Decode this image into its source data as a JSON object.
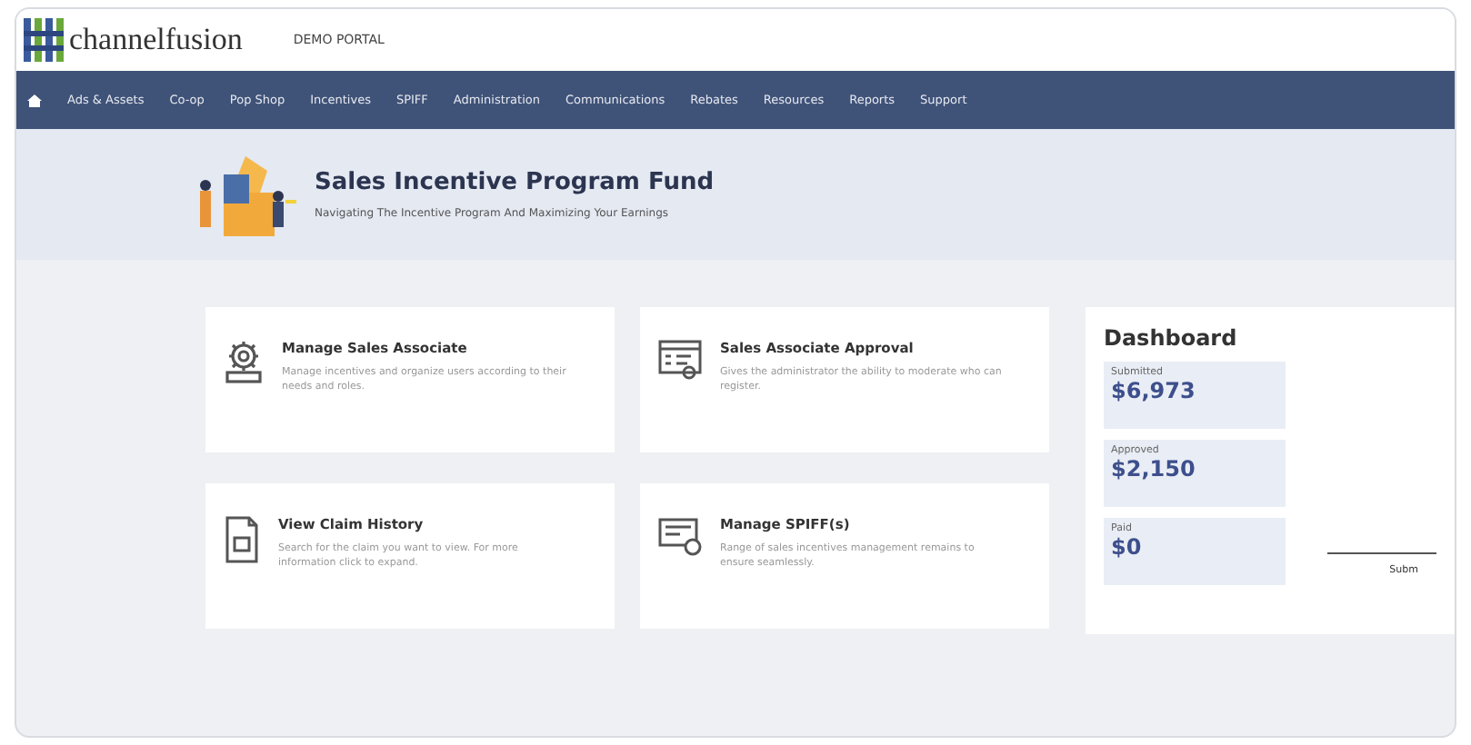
{
  "header": {
    "logo_text": "channelfusion",
    "portal_label": "DEMO PORTAL"
  },
  "nav": {
    "items": [
      "Ads & Assets",
      "Co-op",
      "Pop Shop",
      "Incentives",
      "SPIFF",
      "Administration",
      "Communications",
      "Rebates",
      "Resources",
      "Reports",
      "Support"
    ]
  },
  "banner": {
    "title": "Sales Incentive Program Fund",
    "subtitle": "Navigating The Incentive Program And Maximizing Your Earnings"
  },
  "cards": [
    {
      "kind": "gear",
      "title": "Manage Sales Associate",
      "description": "Manage incentives and organize users according to their needs and roles."
    },
    {
      "kind": "form",
      "title": "Sales Associate Approval",
      "description": "Gives the administrator the ability to moderate who can register."
    },
    {
      "kind": "document",
      "title": "View Claim History",
      "description": "Search for the claim you want to view. For more information click to expand."
    },
    {
      "kind": "screen",
      "title": "Manage SPIFF(s)",
      "description": "Range of sales incentives management remains to ensure seamlessly."
    }
  ],
  "dashboard": {
    "title": "Dashboard",
    "stats": [
      {
        "label": "Submitted",
        "value": "$6,973"
      },
      {
        "label": "Approved",
        "value": "$2,150"
      },
      {
        "label": "Paid",
        "value": "$0"
      }
    ],
    "chart_label": "Subm"
  }
}
